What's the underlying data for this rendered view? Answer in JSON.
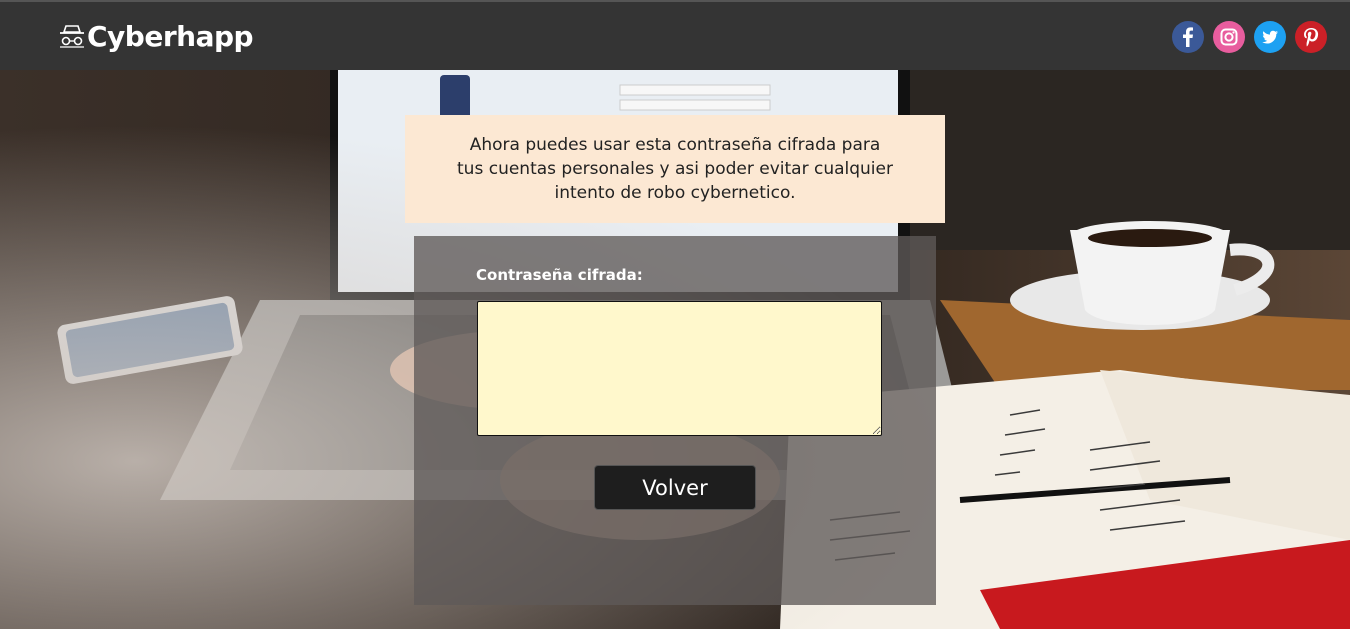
{
  "header": {
    "brand_name": "Cyberhapp",
    "brand_icon": "incognito-icon",
    "socials": [
      {
        "name": "facebook",
        "icon": "facebook-icon",
        "color": "#3b5998"
      },
      {
        "name": "instagram",
        "icon": "instagram-icon",
        "color": "#e85d9e"
      },
      {
        "name": "twitter",
        "icon": "twitter-icon",
        "color": "#1da1f2"
      },
      {
        "name": "pinterest",
        "icon": "pinterest-icon",
        "color": "#cb2027"
      }
    ]
  },
  "notice": {
    "text": "Ahora puedes usar esta contraseña cifrada para tus cuentas personales y asi poder evitar cualquier intento de robo cybernetico."
  },
  "form": {
    "label": "Contraseña cifrada:",
    "value": "",
    "button_label": "Volver"
  },
  "colors": {
    "header_bg": "#343434",
    "notice_bg": "#fce8d3",
    "textarea_bg": "#fff8cc",
    "button_bg": "#1e1e1e"
  }
}
